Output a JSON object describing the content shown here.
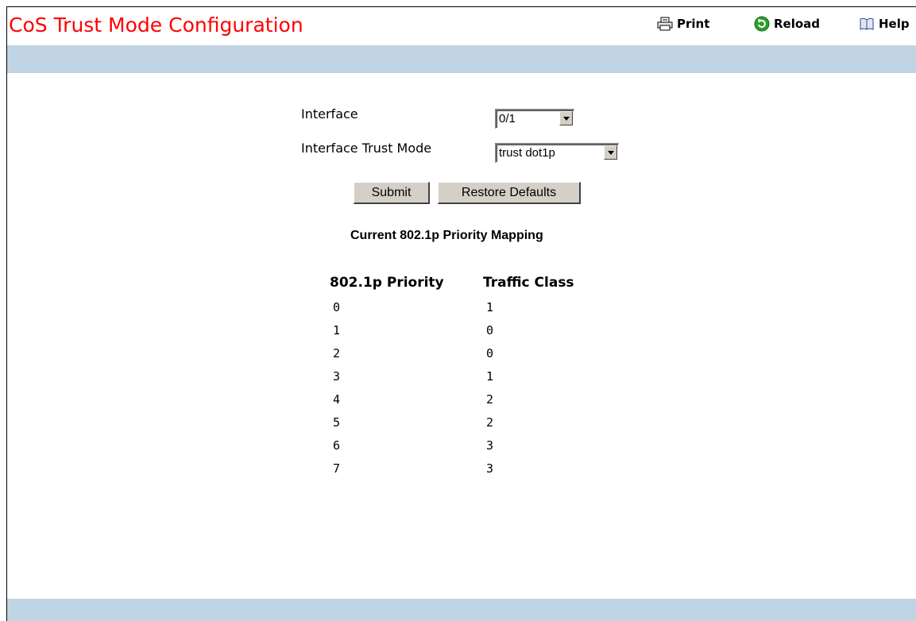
{
  "page": {
    "title": "CoS Trust Mode Configuration"
  },
  "toolbar": {
    "print": "Print",
    "reload": "Reload",
    "help": "Help"
  },
  "form": {
    "interface_label": "Interface",
    "interface_value": "0/1",
    "trust_mode_label": "Interface Trust Mode",
    "trust_mode_value": "trust dot1p",
    "submit_label": "Submit",
    "restore_label": "Restore Defaults"
  },
  "mapping": {
    "title": "Current 802.1p Priority Mapping",
    "col_priority": "802.1p Priority",
    "col_class": "Traffic Class",
    "rows": [
      {
        "priority": "0",
        "class": "1"
      },
      {
        "priority": "1",
        "class": "0"
      },
      {
        "priority": "2",
        "class": "0"
      },
      {
        "priority": "3",
        "class": "1"
      },
      {
        "priority": "4",
        "class": "2"
      },
      {
        "priority": "5",
        "class": "2"
      },
      {
        "priority": "6",
        "class": "3"
      },
      {
        "priority": "7",
        "class": "3"
      }
    ]
  },
  "colors": {
    "title": "#ff0000",
    "band": "#c0d4e4",
    "button": "#d4d0c8"
  },
  "icons": {
    "print": "printer-icon",
    "reload": "reload-icon",
    "help": "help-book-icon"
  }
}
